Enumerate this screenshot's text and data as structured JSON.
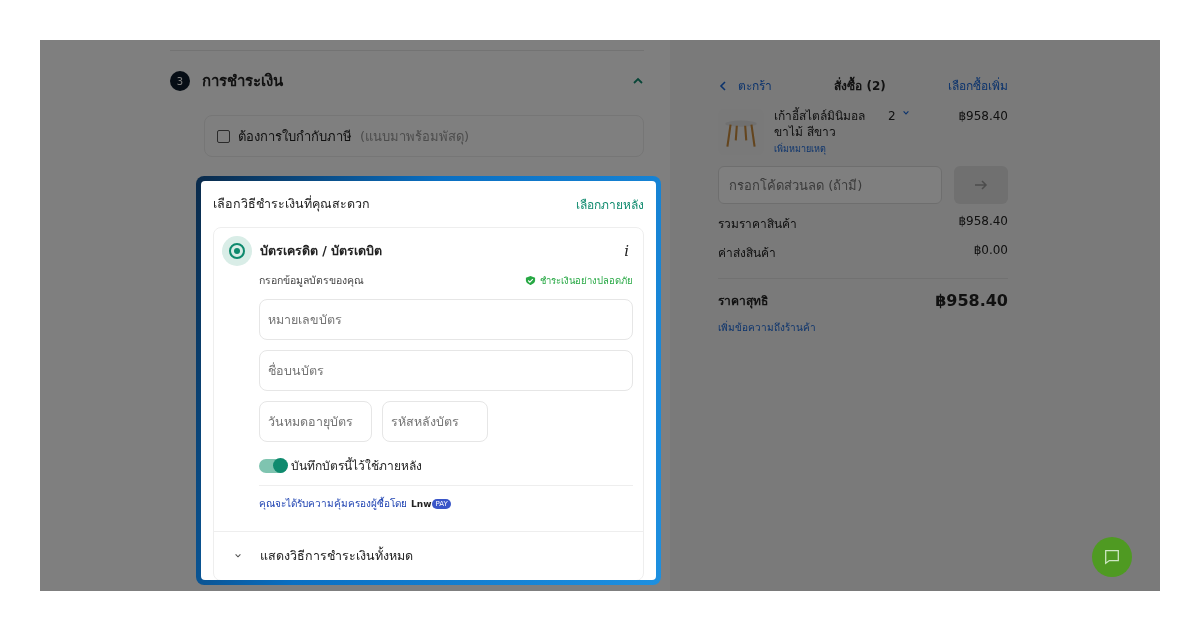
{
  "section": {
    "number": "3",
    "title": "การชำระเงิน",
    "expanded": true
  },
  "tax_invoice": {
    "label": "ต้องการใบกำกับภาษี",
    "hint": "(แนบมาพร้อมพัสดุ)",
    "checked": false
  },
  "payment": {
    "heading": "เลือกวิธีชำระเงินที่คุณสะดวก",
    "choose_later": "เลือกภายหลัง",
    "method": {
      "name": "บัตรเครดิต / บัตรเดบิต",
      "selected": true,
      "info": "i",
      "subtitle": "กรอกข้อมูลบัตรของคุณ",
      "secure_label": "ชำระเงินอย่างปลอดภัย",
      "fields": [
        {
          "placeholder": "หมายเลขบัตร",
          "kind": "wide"
        },
        {
          "placeholder": "ชื่อบนบัตร",
          "kind": "wide"
        },
        {
          "placeholder": "วันหมดอายุบัตร",
          "kind": "narrow"
        },
        {
          "placeholder": "รหัสหลังบัตร",
          "kind": "narrow"
        }
      ],
      "save_card": {
        "label": "บันทึกบัตรนี้ไว้ใช้ภายหลัง",
        "on": true
      },
      "protection_text": "คุณจะได้รับความคุ้มครองผู้ซื้อโดย",
      "logo_text": "Lnw",
      "logo_badge": "PAY"
    },
    "show_all": "แสดงวิธีการชำระเงินทั้งหมด"
  },
  "order": {
    "back_label": "ตะกร้า",
    "title": "สั่งซื้อ (2)",
    "add_more": "เลือกซื้อเพิ่ม",
    "items": [
      {
        "name": "เก้าอี้สไตล์มินิมอล ขาไม้ สีขาว",
        "quantity": "2",
        "price": "฿958.40",
        "note_link": "เพิ่มหมายเหตุ"
      }
    ],
    "coupon_placeholder": "กรอกโค้ดส่วนลด (ถ้ามี)",
    "summary": [
      {
        "label": "รวมราคาสินค้า",
        "value": "฿958.40"
      },
      {
        "label": "ค่าส่งสินค้า",
        "value": "฿0.00"
      }
    ],
    "total": {
      "label": "ราคาสุทธิ",
      "value": "฿958.40"
    },
    "message_link": "เพิ่มข้อความถึงร้านค้า"
  }
}
